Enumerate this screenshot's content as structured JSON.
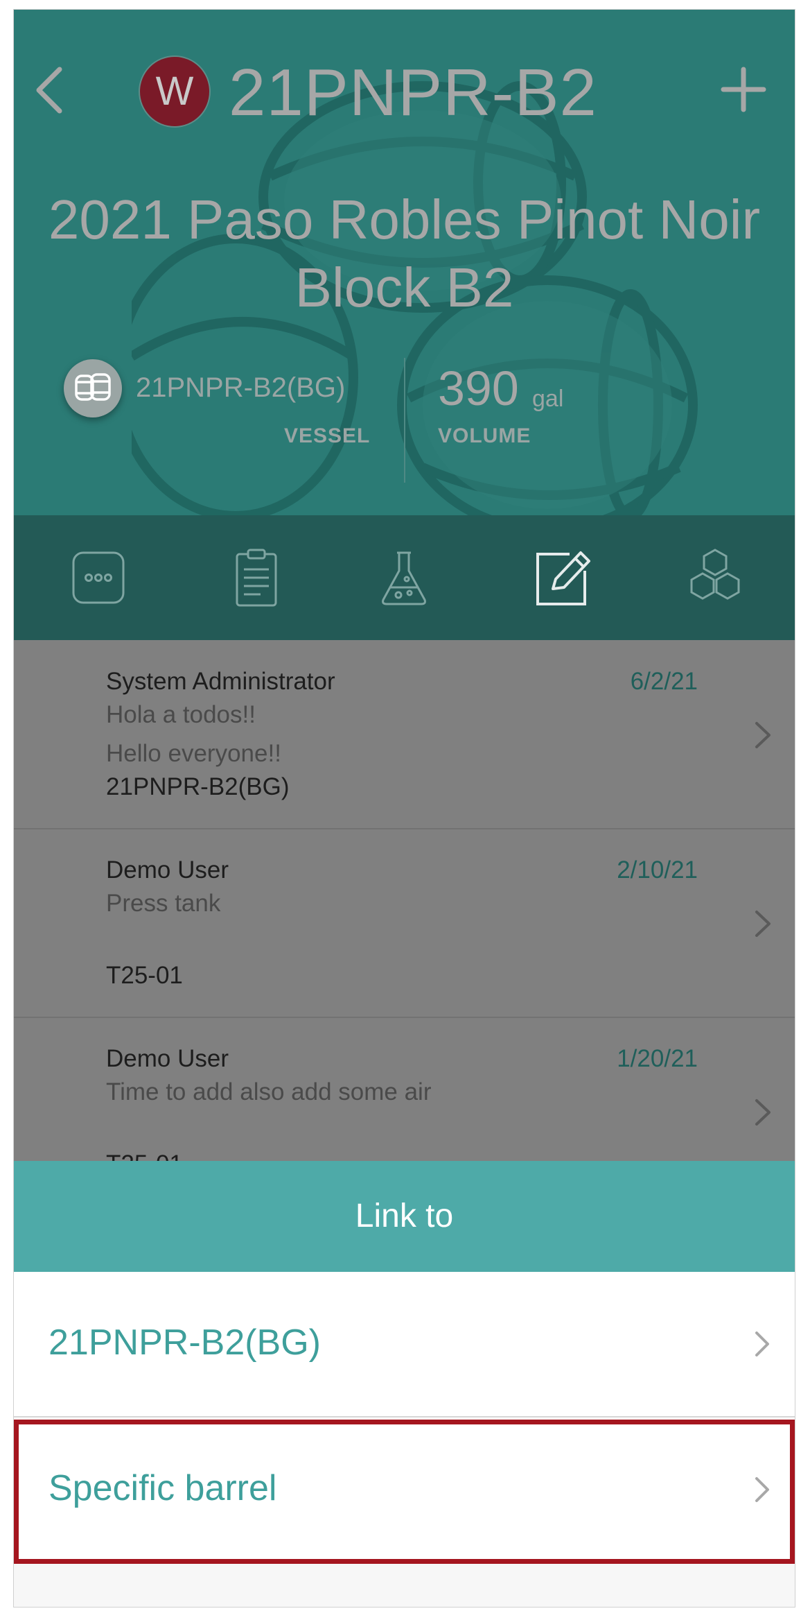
{
  "header": {
    "logo_letter": "W",
    "code": "21PNPR-B2",
    "wine_name": "2021 Paso Robles Pinot Noir Block B2",
    "vessel_name": "21PNPR-B2(BG)",
    "vessel_caption": "VESSEL",
    "volume_value": "390",
    "volume_unit": "gal",
    "volume_caption": "VOLUME"
  },
  "tabs": [
    {
      "icon": "more-icon"
    },
    {
      "icon": "clipboard-icon"
    },
    {
      "icon": "flask-icon"
    },
    {
      "icon": "edit-note-icon"
    },
    {
      "icon": "hexagons-icon"
    }
  ],
  "notes": [
    {
      "author": "System Administrator",
      "date": "6/2/21",
      "lines": [
        "Hola a todos!!",
        "Hello everyone!!"
      ],
      "vessel": "21PNPR-B2(BG)"
    },
    {
      "author": "Demo User",
      "date": "2/10/21",
      "lines": [
        "Press tank"
      ],
      "vessel": "T25-01"
    },
    {
      "author": "Demo User",
      "date": "1/20/21",
      "lines": [
        "Time to add also add some air"
      ],
      "vessel": "T25-01"
    }
  ],
  "sheet": {
    "title": "Link to",
    "options": [
      {
        "label": "21PNPR-B2(BG)"
      },
      {
        "label": "Specific barrel"
      }
    ]
  },
  "colors": {
    "hero": "#2b7b75",
    "tab_bar": "#235a56",
    "sheet_header": "#4eaaa8",
    "accent_text": "#3e9f9b",
    "highlight": "#a5161f"
  }
}
